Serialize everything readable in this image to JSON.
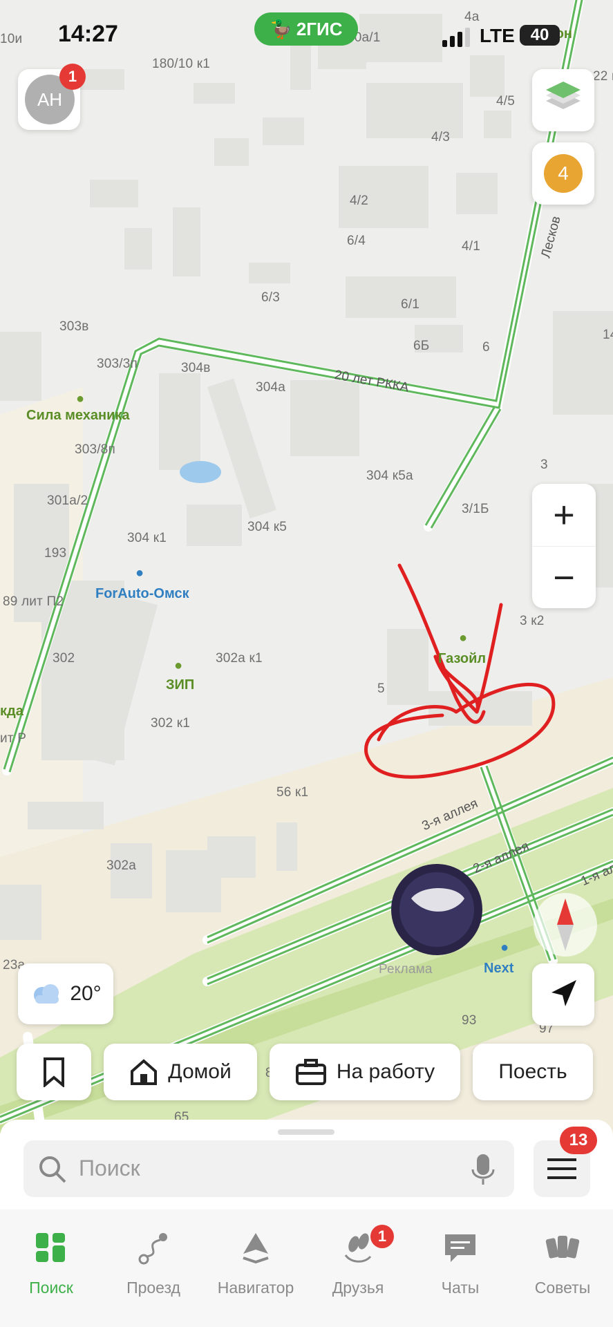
{
  "status_bar": {
    "time": "14:27",
    "network": "LTE",
    "battery": "40"
  },
  "brand": {
    "name": "2ГИС"
  },
  "profile": {
    "initials": "АН",
    "notification_count": "1"
  },
  "map": {
    "labels": [
      {
        "text": "10и"
      },
      {
        "text": "180/10 к1"
      },
      {
        "text": "30а/1"
      },
      {
        "text": "4а"
      },
      {
        "text": "22 к"
      },
      {
        "text": "4/5"
      },
      {
        "text": "4/3"
      },
      {
        "text": "4/2"
      },
      {
        "text": "6/4"
      },
      {
        "text": "4/1"
      },
      {
        "text": "6/3"
      },
      {
        "text": "6/1"
      },
      {
        "text": "303в"
      },
      {
        "text": "6Б"
      },
      {
        "text": "6"
      },
      {
        "text": "303/3п"
      },
      {
        "text": "304в"
      },
      {
        "text": "304а"
      },
      {
        "text": "14"
      },
      {
        "text": "303/8п"
      },
      {
        "text": "304 к5а"
      },
      {
        "text": "3"
      },
      {
        "text": "301а/2"
      },
      {
        "text": "3/1Б"
      },
      {
        "text": "304 к5"
      },
      {
        "text": "304 к1"
      },
      {
        "text": "193"
      },
      {
        "text": "89 лит П2"
      },
      {
        "text": "3 к2"
      },
      {
        "text": "302"
      },
      {
        "text": "302а к1"
      },
      {
        "text": "5"
      },
      {
        "text": "302 к1"
      },
      {
        "text": "ит Р"
      },
      {
        "text": "56 к1"
      },
      {
        "text": "302а"
      },
      {
        "text": "23а"
      },
      {
        "text": "93"
      },
      {
        "text": "97"
      },
      {
        "text": "8"
      },
      {
        "text": "65"
      }
    ],
    "streets": {
      "rkka": "20 лет РККА",
      "alley3": "3-я аллея",
      "alley2": "2-я аллея",
      "alley1": "1-я ал",
      "leskov": "Лесков"
    },
    "pois": {
      "sila": "Сила механика",
      "forauto": "ForAuto-Омск",
      "zip": "ЗИП",
      "gazoil": "Газойл",
      "kda": "кда",
      "don": "Зе Дон",
      "next": "Next",
      "ad": "Реклама"
    }
  },
  "layers_count": "4",
  "weather": {
    "temp": "20°"
  },
  "quick_chips": {
    "home": "Домой",
    "work": "На работу",
    "eat": "Поесть"
  },
  "search": {
    "placeholder": "Поиск",
    "menu_badge": "13"
  },
  "tabs": [
    {
      "label": "Поиск",
      "icon": "grid-icon",
      "active": true
    },
    {
      "label": "Проезд",
      "icon": "route-icon"
    },
    {
      "label": "Навигатор",
      "icon": "navigator-icon"
    },
    {
      "label": "Друзья",
      "icon": "friends-icon",
      "badge": "1"
    },
    {
      "label": "Чаты",
      "icon": "chat-icon"
    },
    {
      "label": "Советы",
      "icon": "tips-icon"
    }
  ],
  "colors": {
    "accent": "#3eb049",
    "badge": "#e53935",
    "layers_badge": "#e8a531",
    "annotation": "#e02020",
    "road_green": "#5fb85c"
  }
}
